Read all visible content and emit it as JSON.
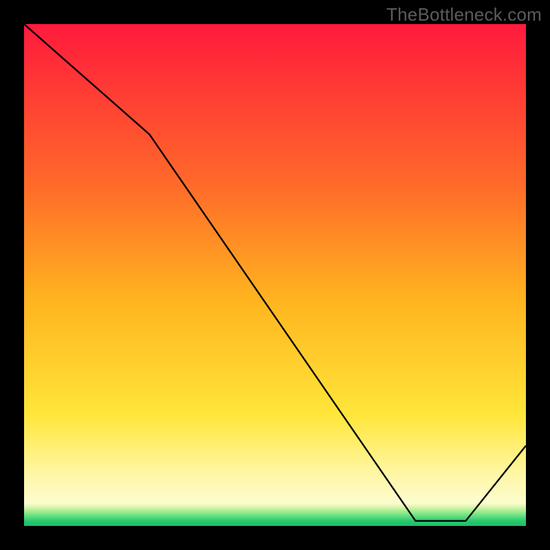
{
  "watermark": "TheBottleneck.com",
  "marker_label": "",
  "chart_data": {
    "type": "line",
    "title": "",
    "xlabel": "",
    "ylabel": "",
    "xlim": [
      0,
      100
    ],
    "ylim": [
      0,
      100
    ],
    "background": {
      "type": "vertical-gradient",
      "description": "red (top) → orange → yellow → pale-yellow → thin green band just above x-axis",
      "stops": [
        {
          "pos": 0.0,
          "color": "#ff1a3c"
        },
        {
          "pos": 0.32,
          "color": "#ff6a2a"
        },
        {
          "pos": 0.55,
          "color": "#ffb41f"
        },
        {
          "pos": 0.78,
          "color": "#ffe63a"
        },
        {
          "pos": 0.9,
          "color": "#fff7a8"
        },
        {
          "pos": 0.955,
          "color": "#fcfccf"
        },
        {
          "pos": 0.963,
          "color": "#d6f5a8"
        },
        {
          "pos": 0.975,
          "color": "#86e888"
        },
        {
          "pos": 0.99,
          "color": "#28c96f"
        },
        {
          "pos": 1.0,
          "color": "#1dbf67"
        }
      ]
    },
    "series": [
      {
        "name": "bottleneck-curve",
        "color": "#000000",
        "x": [
          0,
          25,
          78,
          88,
          100
        ],
        "y": [
          100,
          78,
          1,
          1,
          16
        ]
      }
    ],
    "optimum": {
      "x_start": 78,
      "x_end": 88,
      "y": 1,
      "label": ""
    }
  }
}
